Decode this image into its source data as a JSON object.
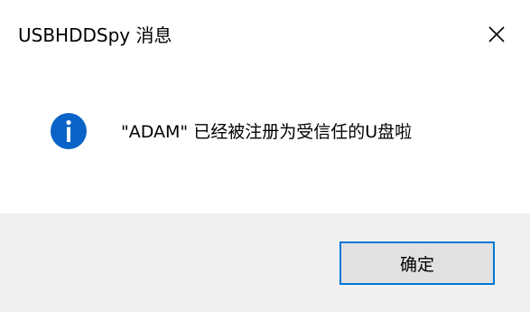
{
  "window": {
    "title": "USBHDDSpy 消息"
  },
  "message": {
    "text": "\"ADAM\" 已经被注册为受信任的U盘啦",
    "icon": "info-icon"
  },
  "buttons": {
    "ok_label": "确定"
  },
  "colors": {
    "info_icon": "#0a64c8",
    "button_border": "#0078d7",
    "button_bg": "#e1e1e1",
    "footer_bg": "#f0f0f0"
  }
}
